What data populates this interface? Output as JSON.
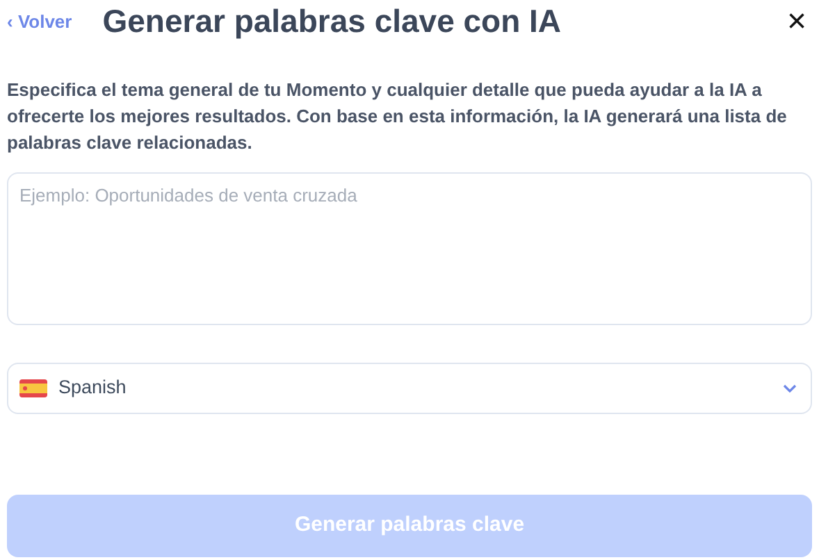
{
  "header": {
    "back": {
      "icon": "‹",
      "label": "Volver"
    },
    "title": "Generar palabras clave con IA",
    "close": "×"
  },
  "description": "Especifica el tema general de tu Momento y cualquier detalle que pueda ayudar a la IA a ofrecerte los mejores resultados. Con base en esta información, la IA generará una lista de palabras clave relacionadas.",
  "topic_field": {
    "placeholder": "Ejemplo: Oportunidades de venta cruzada"
  },
  "language_select": {
    "value": "Spanish"
  },
  "generate_button": {
    "label": "Generar palabras clave",
    "disabled": true
  }
}
